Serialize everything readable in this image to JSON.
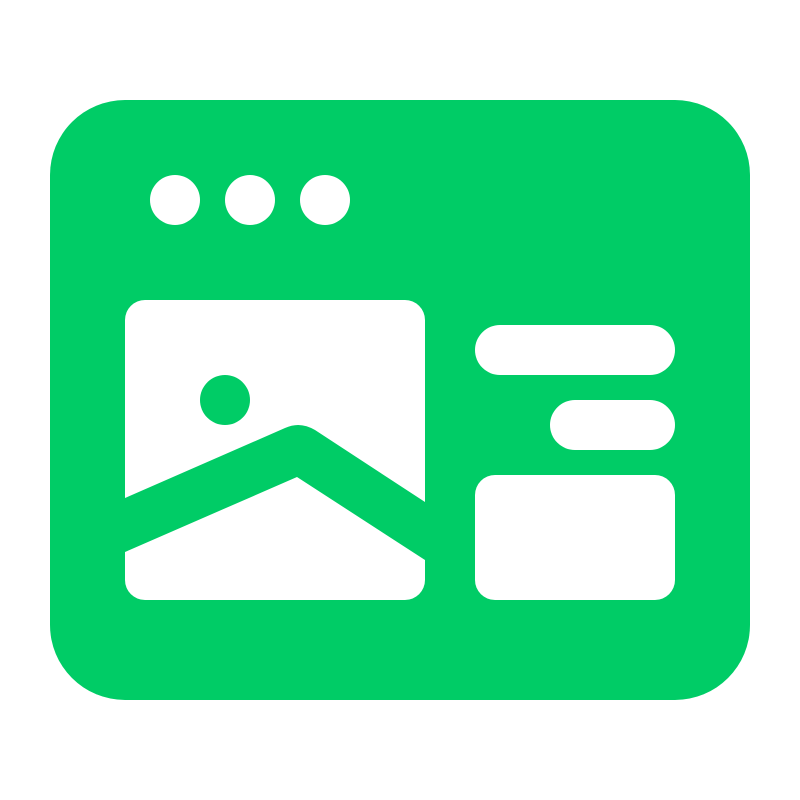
{
  "icon": {
    "name": "browser-window-image-layout-icon",
    "colors": {
      "accent": "#00cc66",
      "foreground": "#ffffff",
      "background": "#ffffff"
    }
  }
}
